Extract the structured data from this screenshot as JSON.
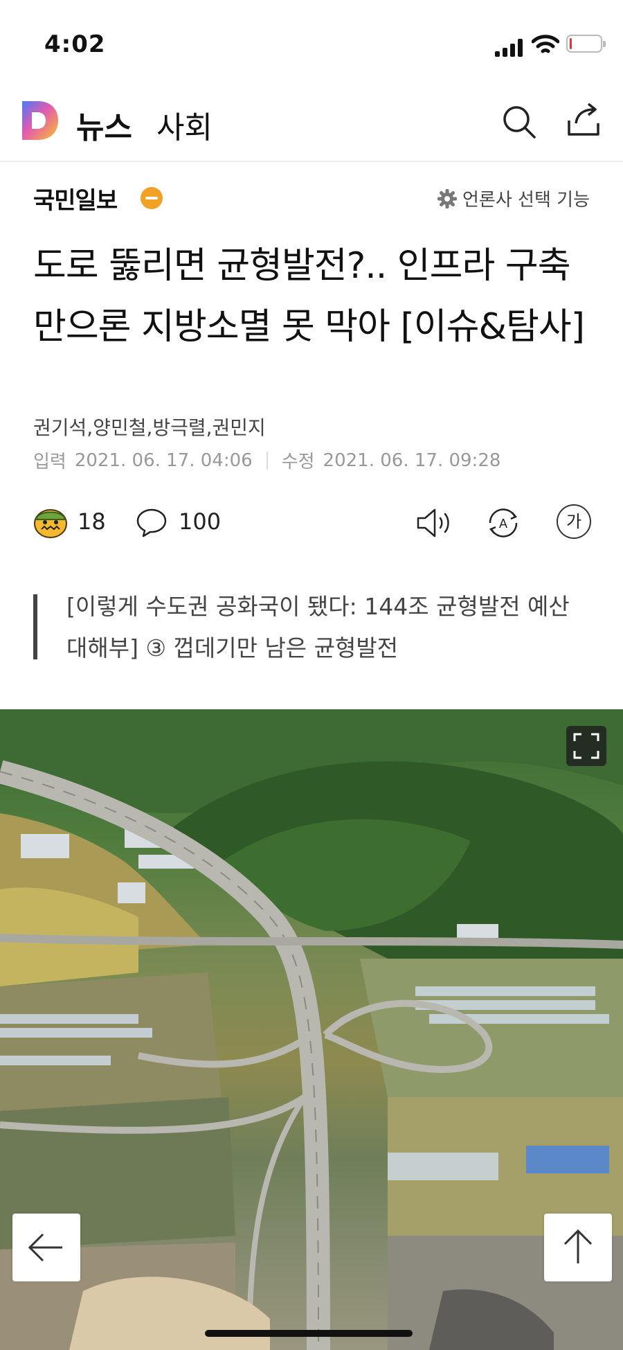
{
  "status_bar": {
    "time": "4:02",
    "battery_level_percent": 5,
    "battery_color": "#e33333"
  },
  "header": {
    "app_name": "뉴스",
    "section": "사회"
  },
  "article": {
    "publisher": "국민일보",
    "publisher_select": "언론사 선택 기능",
    "title": "도로 뚫리면 균형발전?.. 인프라 구축만으론 지방소멸 못 막아 [이슈&탐사]",
    "authors": "권기석,양민철,방극렬,권민지",
    "input_label": "입력",
    "input_date": "2021. 06. 17. 04:06",
    "modified_label": "수정",
    "modified_date": "2021. 06. 17. 09:28",
    "reaction_count": "18",
    "comment_count": "100",
    "font_button": "가",
    "subtitle": "[이렇게 수도권 공화국이 됐다: 144조 균형발전 예산 대해부] ③ 껍데기만 남은 균형발전"
  },
  "icons": {
    "logo": "daum-logo-icon",
    "search": "search-icon",
    "share": "share-icon",
    "settings": "gear-icon",
    "reaction": "emoji-reaction-icon",
    "comment": "comment-icon",
    "tts": "speaker-icon",
    "translate": "translate-icon",
    "expand": "expand-icon",
    "back": "arrow-left-icon",
    "top": "arrow-up-icon"
  },
  "colors": {
    "publisher_badge": "#f2a127",
    "accent_logo": "#f5a623"
  }
}
